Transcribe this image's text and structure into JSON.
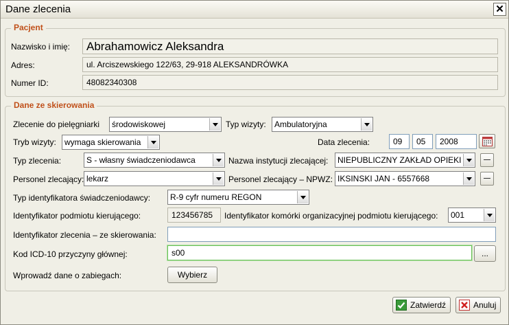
{
  "window": {
    "title": "Dane zlecenia",
    "close_glyph": "✕"
  },
  "pacjent": {
    "legend": "Pacjent",
    "name_label": "Nazwisko i imię:",
    "name_value": "Abrahamowicz Aleksandra",
    "address_label": "Adres:",
    "address_value": "ul. Arciszewskiego 122/63, 29-918 ALEKSANDRÓWKA",
    "id_label": "Numer ID:",
    "id_value": "48082340308"
  },
  "skierowanie": {
    "legend": "Dane ze skierowania",
    "zlecenie_label": "Zlecenie do pielęgniarki",
    "zlecenie_value": "środowiskowej",
    "typ_wizyty_label": "Typ wizyty:",
    "typ_wizyty_value": "Ambulatoryjna",
    "tryb_label": "Tryb wizyty:",
    "tryb_value": "wymaga skierowania",
    "data_label": "Data zlecenia:",
    "data_day": "09",
    "data_month": "05",
    "data_year": "2008",
    "typ_zlecenia_label": "Typ zlecenia:",
    "typ_zlecenia_value": "S - własny świadczeniodawca",
    "instytucja_label": "Nazwa instytucji zlecającej:",
    "instytucja_value": "NIEPUBLICZNY ZAKŁAD OPIEKI Z",
    "personel_label": "Personel zlecający:",
    "personel_value": "lekarz",
    "npwz_label": "Personel zlecający – NPWZ:",
    "npwz_value": "IKSINSKI JAN - 6557668",
    "typ_ident_label": "Typ identyfikatora świadczeniodawcy:",
    "typ_ident_value": "R-9 cyfr numeru REGON",
    "ident_podm_label": "Identyfikator podmiotu kierującego:",
    "ident_podm_value": "123456785",
    "ident_kom_label": "Identyfikator komórki organizacyjnej podmiotu kierującego:",
    "ident_kom_value": "001",
    "ident_zlec_label": "Identyfikator zlecenia – ze skierowania:",
    "ident_zlec_value": "",
    "icd_label": "Kod ICD-10 przyczyny głównej:",
    "icd_value": "s00",
    "ellipsis_label": "...",
    "zabiegi_label": "Wprowadź dane o zabiegach:",
    "wybierz_label": "Wybierz"
  },
  "footer": {
    "confirm_label": "Zatwierdź",
    "cancel_label": "Anuluj"
  },
  "colors": {
    "legend": "#c0501a",
    "focus_border": "#6bbf59"
  }
}
